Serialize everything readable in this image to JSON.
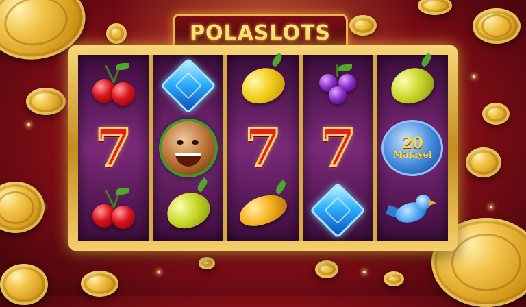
{
  "title": "POLASLOTS",
  "reels": [
    {
      "symbols": [
        "cherry",
        "seven",
        "cherry"
      ]
    },
    {
      "symbols": [
        "blue-gem",
        "wild-character",
        "green-lemon"
      ]
    },
    {
      "symbols": [
        "lemon",
        "seven",
        "orange-lemon"
      ]
    },
    {
      "symbols": [
        "grapes",
        "seven",
        "blue-gem"
      ]
    },
    {
      "symbols": [
        "green-lemon",
        "bonus",
        "bird"
      ]
    }
  ],
  "symbol_text": {
    "seven": "7",
    "bonus_number": "20",
    "bonus_word": "Malayel"
  },
  "colors": {
    "background": "#8f1018",
    "frame_gold": "#e7b64a",
    "reel_purple": "#7a2a78",
    "seven_red": "#e32020"
  }
}
